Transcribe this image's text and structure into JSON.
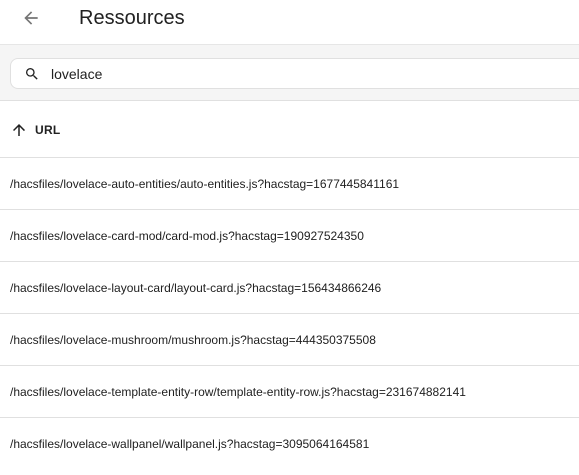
{
  "header": {
    "title": "Ressources",
    "back_icon": "arrow-left-icon"
  },
  "search": {
    "value": "lovelace",
    "icon": "search-icon"
  },
  "table": {
    "column_label": "URL",
    "sort_icon": "arrow-up-icon",
    "rows": [
      "/hacsfiles/lovelace-auto-entities/auto-entities.js?hacstag=1677445841161",
      "/hacsfiles/lovelace-card-mod/card-mod.js?hacstag=190927524350",
      "/hacsfiles/lovelace-layout-card/layout-card.js?hacstag=156434866246",
      "/hacsfiles/lovelace-mushroom/mushroom.js?hacstag=444350375508",
      "/hacsfiles/lovelace-template-entity-row/template-entity-row.js?hacstag=231674882141",
      "/hacsfiles/lovelace-wallpanel/wallpanel.js?hacstag=3095064164581"
    ]
  },
  "colors": {
    "text": "#212121",
    "icon": "#616161",
    "divider": "#e0e0e0",
    "toolbar_bg": "#f5f5f5"
  }
}
